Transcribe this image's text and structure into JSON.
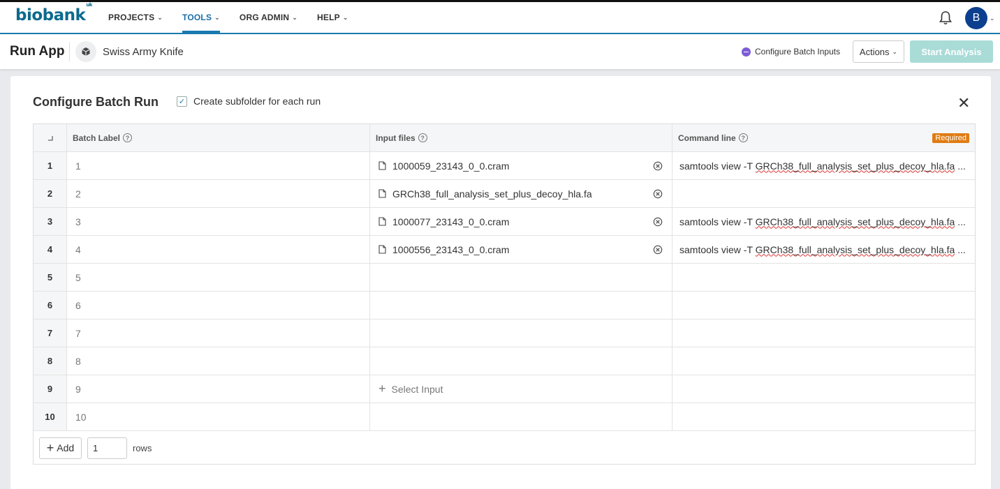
{
  "nav": {
    "logo": "biobank",
    "logo_sup": "uk",
    "items": [
      {
        "label": "PROJECTS",
        "active": false
      },
      {
        "label": "TOOLS",
        "active": true
      },
      {
        "label": "ORG ADMIN",
        "active": false
      },
      {
        "label": "HELP",
        "active": false
      }
    ],
    "avatar_initial": "B"
  },
  "subheader": {
    "title": "Run App",
    "app_name": "Swiss Army Knife",
    "status": "Configure Batch Inputs",
    "actions_label": "Actions",
    "start_label": "Start Analysis"
  },
  "panel": {
    "title": "Configure Batch Run",
    "subfolder_label": "Create subfolder for each run",
    "subfolder_checked": true
  },
  "table": {
    "headers": {
      "batch_label": "Batch Label",
      "input_files": "Input files",
      "command_line": "Command line",
      "required": "Required"
    },
    "rows": [
      {
        "num": "1",
        "label": "1",
        "file": "1000059_23143_0_0.cram",
        "cmd_prefix": "samtools view -T ",
        "cmd_ref": "GRCh38_full_analysis_set_plus_decoy_hla.fa",
        "cmd_suffix": " ..."
      },
      {
        "num": "2",
        "label": "2",
        "file": "GRCh38_full_analysis_set_plus_decoy_hla.fa",
        "cmd_prefix": "",
        "cmd_ref": "",
        "cmd_suffix": ""
      },
      {
        "num": "3",
        "label": "3",
        "file": "1000077_23143_0_0.cram",
        "cmd_prefix": "samtools view -T ",
        "cmd_ref": "GRCh38_full_analysis_set_plus_decoy_hla.fa",
        "cmd_suffix": " ..."
      },
      {
        "num": "4",
        "label": "4",
        "file": "1000556_23143_0_0.cram",
        "cmd_prefix": "samtools view -T ",
        "cmd_ref": "GRCh38_full_analysis_set_plus_decoy_hla.fa",
        "cmd_suffix": " ..."
      },
      {
        "num": "5",
        "label": "5",
        "file": "",
        "cmd_prefix": "",
        "cmd_ref": "",
        "cmd_suffix": ""
      },
      {
        "num": "6",
        "label": "6",
        "file": "",
        "cmd_prefix": "",
        "cmd_ref": "",
        "cmd_suffix": ""
      },
      {
        "num": "7",
        "label": "7",
        "file": "",
        "cmd_prefix": "",
        "cmd_ref": "",
        "cmd_suffix": ""
      },
      {
        "num": "8",
        "label": "8",
        "file": "",
        "cmd_prefix": "",
        "cmd_ref": "",
        "cmd_suffix": ""
      },
      {
        "num": "9",
        "label": "9",
        "file": "",
        "select_input": "Select Input",
        "cmd_prefix": "",
        "cmd_ref": "",
        "cmd_suffix": ""
      },
      {
        "num": "10",
        "label": "10",
        "file": "",
        "cmd_prefix": "",
        "cmd_ref": "",
        "cmd_suffix": ""
      }
    ],
    "footer": {
      "add_label": "Add",
      "rows_value": "1",
      "rows_label": "rows"
    }
  },
  "colors": {
    "brand": "#0c6a8e",
    "accent": "#1a7ab0",
    "start_disabled": "#a9dbd7",
    "required": "#e07c12",
    "status_dot": "#7b5cd6"
  }
}
